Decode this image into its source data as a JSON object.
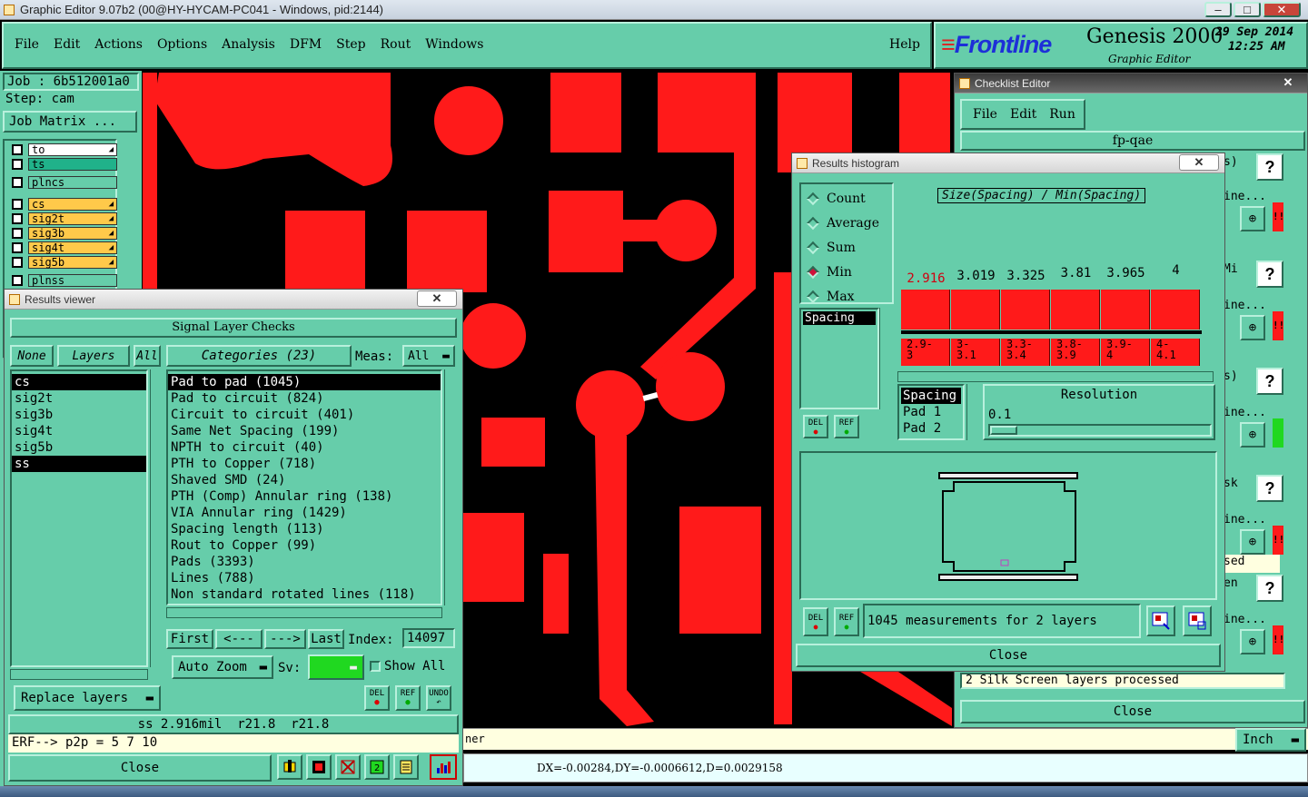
{
  "window": {
    "title": "Graphic Editor 9.07b2 (00@HY-HYCAM-PC041 - Windows, pid:2144)",
    "controls": [
      "–",
      "□",
      "✕"
    ]
  },
  "menubar": {
    "items": [
      "File",
      "Edit",
      "Actions",
      "Options",
      "Analysis",
      "DFM",
      "Step",
      "Rout",
      "Windows"
    ],
    "help": "Help"
  },
  "brand": {
    "logo": "Frontline",
    "product": "Genesis 2000",
    "subtitle": "Graphic Editor",
    "date": "29 Sep 2014",
    "time": "12:25 AM"
  },
  "job_panel": {
    "job": "Job : 6b512001a0",
    "step": "Step: cam",
    "matrix_button": "Job Matrix ...",
    "layers": [
      {
        "name": "to",
        "color": "#ffffff",
        "arrow": true
      },
      {
        "name": "ts",
        "color": "#20b28a",
        "arrow": false
      },
      {
        "name": "plncs",
        "color": "#66cdaa",
        "arrow": false
      },
      {
        "name": "cs",
        "color": "#ffc94a",
        "arrow": true
      },
      {
        "name": "sig2t",
        "color": "#ffc94a",
        "arrow": true
      },
      {
        "name": "sig3b",
        "color": "#ffc94a",
        "arrow": true
      },
      {
        "name": "sig4t",
        "color": "#ffc94a",
        "arrow": true
      },
      {
        "name": "sig5b",
        "color": "#ffc94a",
        "arrow": true
      },
      {
        "name": "plnss",
        "color": "#66cdaa",
        "arrow": false
      }
    ]
  },
  "results_viewer": {
    "title": "Results viewer",
    "close_x": "✕",
    "header": "Signal Layer Checks",
    "none_btn": "None",
    "layers_btn": "Layers",
    "all_btn": "All",
    "categories_btn": "Categories (23)",
    "meas_label": "Meas:",
    "meas_value": "All",
    "layers": [
      "cs",
      "sig2t",
      "sig3b",
      "sig4t",
      "sig5b",
      "ss"
    ],
    "categories": [
      "Pad to pad (1045)",
      "Pad to circuit (824)",
      "Circuit to circuit (401)",
      "Same Net Spacing (199)",
      "NPTH to circuit (40)",
      "PTH to Copper (718)",
      "Shaved SMD (24)",
      "PTH (Comp) Annular ring (138)",
      "VIA Annular ring (1429)",
      "Spacing length (113)",
      "Rout to Copper (99)",
      "Pads (3393)",
      "Lines (788)",
      "Non standard rotated lines (118)"
    ],
    "nav": {
      "first": "First",
      "prev": "<---",
      "next": "--->",
      "last": "Last",
      "index_label": "Index:",
      "index_value": "14097"
    },
    "auto_zoom": "Auto Zoom",
    "sv_label": "Sv:",
    "show_all": "Show All",
    "replace_layers": "Replace layers",
    "del": "DEL",
    "ref": "REF",
    "undo": "UNDO",
    "status": "ss 2.916mil  r21.8  r21.8",
    "erf": "ERF--> p2p = 5 7 10",
    "close": "Close"
  },
  "histogram": {
    "title": "Results histogram",
    "close_x": "✕",
    "modes": [
      "Count",
      "Average",
      "Sum",
      "Min",
      "Max"
    ],
    "selected_mode": "Min",
    "chart_title": "Size(Spacing) / Min(Spacing)",
    "list_item": "Spacing",
    "bins": [
      {
        "value": "2.916",
        "range": "2.9-\n3"
      },
      {
        "value": "3.019",
        "range": "3-\n3.1"
      },
      {
        "value": "3.325",
        "range": "3.3-\n3.4"
      },
      {
        "value": "3.81",
        "range": "3.8-\n3.9"
      },
      {
        "value": "3.965",
        "range": "3.9-\n4"
      },
      {
        "value": "4",
        "range": "4-\n4.1"
      }
    ],
    "fields": [
      "Spacing",
      "Pad 1",
      "Pad 2"
    ],
    "resolution_label": "Resolution",
    "resolution_value": "0.1",
    "summary": "1045 measurements for 2 layers",
    "close": "Close",
    "del": "DEL",
    "ref": "REF"
  },
  "checklist": {
    "title": "Checklist Editor",
    "menu": [
      "File",
      "Edit",
      "Run"
    ],
    "name": "fp-qae",
    "row_labels": [
      "s)",
      "ine...",
      "Mi",
      "ine...",
      "s)",
      "ine...",
      "sk",
      "ine...",
      "sed",
      "en",
      "ine..."
    ],
    "message": "2 Silk Screen layers processed",
    "close": "Close",
    "help_glyph": "?",
    "alert_glyph": "!!"
  },
  "bottom": {
    "units": "Inch",
    "coords": "DX=-0.00284,DY=-0.0006612,D=0.0029158",
    "partial": "ner"
  }
}
